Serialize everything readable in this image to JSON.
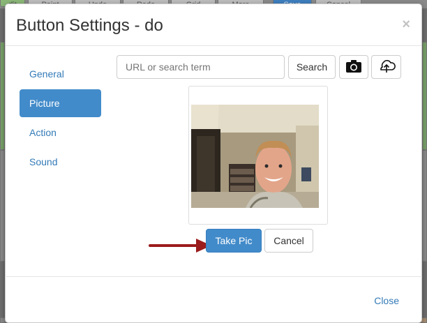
{
  "background": {
    "tabs": [
      {
        "label": "dit"
      },
      {
        "label": "Paint"
      },
      {
        "label": "Undo"
      },
      {
        "label": "Redo"
      },
      {
        "label": "Grid"
      },
      {
        "label": "More"
      },
      {
        "label": "Save"
      },
      {
        "label": "Cancel"
      }
    ]
  },
  "modal": {
    "title": "Button Settings - do",
    "close_symbol": "×"
  },
  "nav": {
    "items": [
      {
        "label": "General"
      },
      {
        "label": "Picture"
      },
      {
        "label": "Action"
      },
      {
        "label": "Sound"
      }
    ],
    "active": "Picture"
  },
  "search": {
    "placeholder": "URL or search term",
    "button_label": "Search"
  },
  "icons": {
    "camera": "camera-icon",
    "upload": "upload-icon",
    "arrow": "arrow-right-icon"
  },
  "actions": {
    "take_pic_label": "Take Pic",
    "cancel_label": "Cancel"
  },
  "footer": {
    "close_label": "Close"
  },
  "colors": {
    "primary": "#428bca",
    "link": "#337ab7",
    "annotation_arrow": "#9b1c1c"
  }
}
